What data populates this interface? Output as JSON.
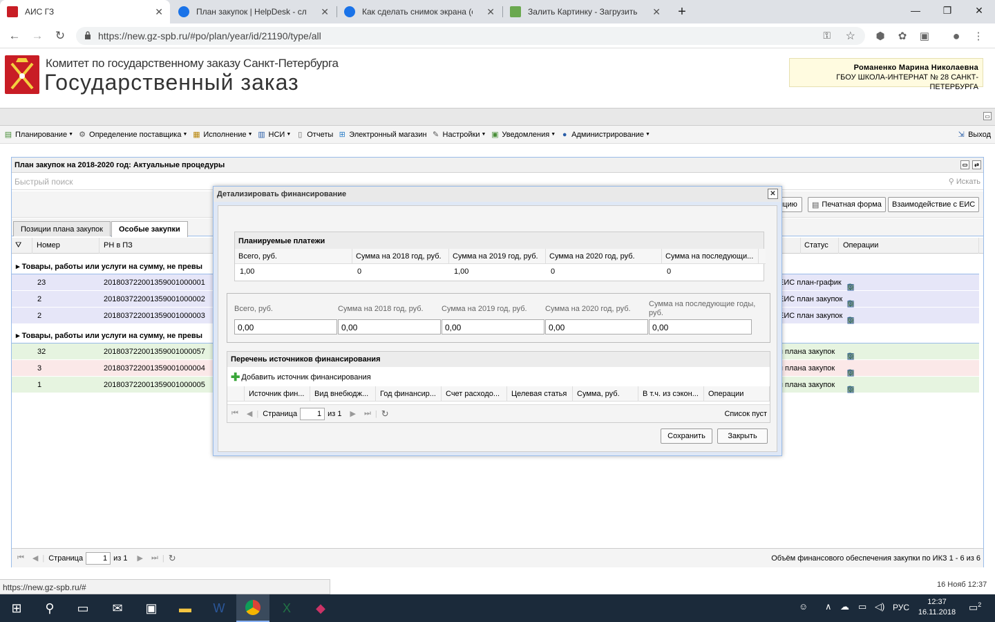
{
  "browser": {
    "tabs": [
      {
        "title": "АИС ГЗ"
      },
      {
        "title": "План закупок | HelpDesk - служ"
      },
      {
        "title": "Как сделать снимок экрана (скр"
      },
      {
        "title": "Залить Картинку - Загрузить фо"
      }
    ],
    "new_tab": "+",
    "minimize": "—",
    "restore": "❐",
    "close": "✕",
    "url": "https://new.gz-spb.ru/#po/plan/year/id/21190/type/all"
  },
  "header": {
    "org": "Комитет по государственному заказу Санкт-Петербурга",
    "system": "Государственный заказ",
    "user_name": "Романенко Марина Николаевна",
    "user_org": "ГБОУ ШКОЛА-ИНТЕРНАТ № 28 САНКТ-ПЕТЕРБУРГА"
  },
  "menu": {
    "items": [
      {
        "label": "Планирование",
        "dropdown": true
      },
      {
        "label": "Определение поставщика",
        "dropdown": true
      },
      {
        "label": "Исполнение",
        "dropdown": true
      },
      {
        "label": "НСИ",
        "dropdown": true
      },
      {
        "label": "Отчеты",
        "dropdown": false
      },
      {
        "label": "Электронный магазин",
        "dropdown": false
      },
      {
        "label": "Настройки",
        "dropdown": true
      },
      {
        "label": "Уведомления",
        "dropdown": true
      },
      {
        "label": "Администрирование",
        "dropdown": true
      }
    ],
    "exit": "Выход"
  },
  "panel": {
    "title": "План закупок на 2018-2020 год: Актуальные процедуры",
    "search_placeholder": "Быстрый поиск",
    "search_button": "Искать",
    "buttons": {
      "partial": "ицию",
      "print": "Печатная форма",
      "eis": "Взаимодействие с ЕИС"
    },
    "tabs": [
      "Позиции плана закупок",
      "Особые закупки"
    ],
    "columns": {
      "number": "Номер",
      "rn": "РН в ПЗ",
      "status": "Статус",
      "ops": "Операции"
    },
    "groups": [
      {
        "title": "Товары, работы или услуги на сумму, не превы",
        "rows": [
          {
            "num": "23",
            "rn": "201803722001359001000001",
            "status": "ЕИС план-график",
            "color": "#e6e6f8"
          },
          {
            "num": "2",
            "rn": "201803722001359001000002",
            "status": "ЕИС план закупок",
            "color": "#e6e6f8"
          },
          {
            "num": "2",
            "rn": "201803722001359001000003",
            "status": "ЕИС план закупок",
            "color": "#e6e6f8"
          }
        ]
      },
      {
        "title": "Товары, работы или услуги на сумму, не превы",
        "rows": [
          {
            "num": "32",
            "rn": "201803722001359001000057",
            "status": "я плана закупок",
            "color": "#e6f4e0"
          },
          {
            "num": "3",
            "rn": "201803722001359001000004",
            "status": "я плана закупок",
            "color": "#fbe8e8"
          },
          {
            "num": "1",
            "rn": "201803722001359001000005",
            "status": "я плана закупок",
            "color": "#e6f4e0"
          }
        ]
      }
    ],
    "pager": {
      "page_label": "Страница",
      "page": "1",
      "of": "из 1",
      "summary": "Объём финансового обеспечения закупки по ИКЗ 1 - 6 из 6"
    }
  },
  "modal": {
    "title": "Детализировать финансирование",
    "planned": {
      "title": "Планируемые платежи",
      "columns": [
        "Всего, руб.",
        "Сумма на 2018 год, руб.",
        "Сумма на 2019 год, руб.",
        "Сумма на 2020 год, руб.",
        "Сумма на последующи..."
      ],
      "values": [
        "1,00",
        "0",
        "1,00",
        "0",
        "0"
      ]
    },
    "fields": [
      {
        "label": "Всего, руб.",
        "value": "0,00"
      },
      {
        "label": "Сумма на 2018 год, руб.",
        "value": "0,00"
      },
      {
        "label": "Сумма на 2019 год, руб.",
        "value": "0,00"
      },
      {
        "label": "Сумма на 2020 год, руб.",
        "value": "0,00"
      },
      {
        "label": "Сумма на последующие годы, руб.",
        "value": "0,00"
      }
    ],
    "sources": {
      "title": "Перечень источников финансирования",
      "add": "Добавить источник финансирования",
      "columns": [
        "Источник фин...",
        "Вид внебюдж...",
        "Год финансир...",
        "Счет расходо...",
        "Целевая статья",
        "Сумма, руб.",
        "В т.ч. из сэкон...",
        "Операции"
      ],
      "page_label": "Страница",
      "page": "1",
      "of": "из 1",
      "empty": "Список пуст"
    },
    "save": "Сохранить",
    "close": "Закрыть"
  },
  "status_url": "https://new.gz-spb.ru/#",
  "datetime_small": "16 Нояб 12:37",
  "taskbar": {
    "lang": "РУС",
    "time": "12:37",
    "date": "16.11.2018",
    "notif": "2"
  }
}
